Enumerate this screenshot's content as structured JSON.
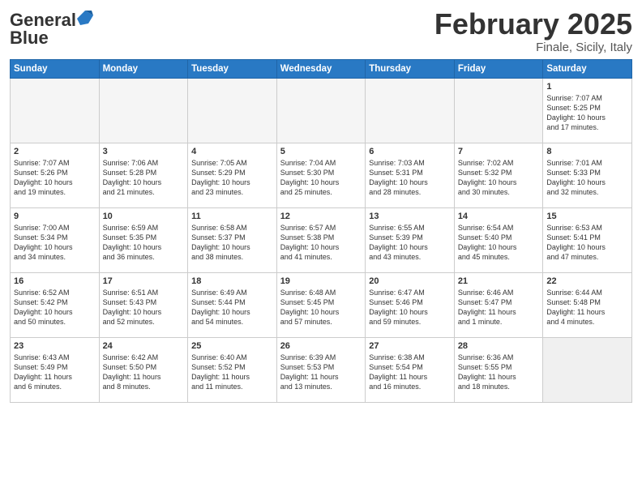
{
  "header": {
    "logo_general": "General",
    "logo_blue": "Blue",
    "month_title": "February 2025",
    "location": "Finale, Sicily, Italy"
  },
  "weekdays": [
    "Sunday",
    "Monday",
    "Tuesday",
    "Wednesday",
    "Thursday",
    "Friday",
    "Saturday"
  ],
  "weeks": [
    [
      {
        "day": "",
        "info": "",
        "empty": true
      },
      {
        "day": "",
        "info": "",
        "empty": true
      },
      {
        "day": "",
        "info": "",
        "empty": true
      },
      {
        "day": "",
        "info": "",
        "empty": true
      },
      {
        "day": "",
        "info": "",
        "empty": true
      },
      {
        "day": "",
        "info": "",
        "empty": true
      },
      {
        "day": "1",
        "info": "Sunrise: 7:07 AM\nSunset: 5:25 PM\nDaylight: 10 hours\nand 17 minutes.",
        "empty": false
      }
    ],
    [
      {
        "day": "2",
        "info": "Sunrise: 7:07 AM\nSunset: 5:26 PM\nDaylight: 10 hours\nand 19 minutes.",
        "empty": false
      },
      {
        "day": "3",
        "info": "Sunrise: 7:06 AM\nSunset: 5:28 PM\nDaylight: 10 hours\nand 21 minutes.",
        "empty": false
      },
      {
        "day": "4",
        "info": "Sunrise: 7:05 AM\nSunset: 5:29 PM\nDaylight: 10 hours\nand 23 minutes.",
        "empty": false
      },
      {
        "day": "5",
        "info": "Sunrise: 7:04 AM\nSunset: 5:30 PM\nDaylight: 10 hours\nand 25 minutes.",
        "empty": false
      },
      {
        "day": "6",
        "info": "Sunrise: 7:03 AM\nSunset: 5:31 PM\nDaylight: 10 hours\nand 28 minutes.",
        "empty": false
      },
      {
        "day": "7",
        "info": "Sunrise: 7:02 AM\nSunset: 5:32 PM\nDaylight: 10 hours\nand 30 minutes.",
        "empty": false
      },
      {
        "day": "8",
        "info": "Sunrise: 7:01 AM\nSunset: 5:33 PM\nDaylight: 10 hours\nand 32 minutes.",
        "empty": false
      }
    ],
    [
      {
        "day": "9",
        "info": "Sunrise: 7:00 AM\nSunset: 5:34 PM\nDaylight: 10 hours\nand 34 minutes.",
        "empty": false
      },
      {
        "day": "10",
        "info": "Sunrise: 6:59 AM\nSunset: 5:35 PM\nDaylight: 10 hours\nand 36 minutes.",
        "empty": false
      },
      {
        "day": "11",
        "info": "Sunrise: 6:58 AM\nSunset: 5:37 PM\nDaylight: 10 hours\nand 38 minutes.",
        "empty": false
      },
      {
        "day": "12",
        "info": "Sunrise: 6:57 AM\nSunset: 5:38 PM\nDaylight: 10 hours\nand 41 minutes.",
        "empty": false
      },
      {
        "day": "13",
        "info": "Sunrise: 6:55 AM\nSunset: 5:39 PM\nDaylight: 10 hours\nand 43 minutes.",
        "empty": false
      },
      {
        "day": "14",
        "info": "Sunrise: 6:54 AM\nSunset: 5:40 PM\nDaylight: 10 hours\nand 45 minutes.",
        "empty": false
      },
      {
        "day": "15",
        "info": "Sunrise: 6:53 AM\nSunset: 5:41 PM\nDaylight: 10 hours\nand 47 minutes.",
        "empty": false
      }
    ],
    [
      {
        "day": "16",
        "info": "Sunrise: 6:52 AM\nSunset: 5:42 PM\nDaylight: 10 hours\nand 50 minutes.",
        "empty": false
      },
      {
        "day": "17",
        "info": "Sunrise: 6:51 AM\nSunset: 5:43 PM\nDaylight: 10 hours\nand 52 minutes.",
        "empty": false
      },
      {
        "day": "18",
        "info": "Sunrise: 6:49 AM\nSunset: 5:44 PM\nDaylight: 10 hours\nand 54 minutes.",
        "empty": false
      },
      {
        "day": "19",
        "info": "Sunrise: 6:48 AM\nSunset: 5:45 PM\nDaylight: 10 hours\nand 57 minutes.",
        "empty": false
      },
      {
        "day": "20",
        "info": "Sunrise: 6:47 AM\nSunset: 5:46 PM\nDaylight: 10 hours\nand 59 minutes.",
        "empty": false
      },
      {
        "day": "21",
        "info": "Sunrise: 6:46 AM\nSunset: 5:47 PM\nDaylight: 11 hours\nand 1 minute.",
        "empty": false
      },
      {
        "day": "22",
        "info": "Sunrise: 6:44 AM\nSunset: 5:48 PM\nDaylight: 11 hours\nand 4 minutes.",
        "empty": false
      }
    ],
    [
      {
        "day": "23",
        "info": "Sunrise: 6:43 AM\nSunset: 5:49 PM\nDaylight: 11 hours\nand 6 minutes.",
        "empty": false
      },
      {
        "day": "24",
        "info": "Sunrise: 6:42 AM\nSunset: 5:50 PM\nDaylight: 11 hours\nand 8 minutes.",
        "empty": false
      },
      {
        "day": "25",
        "info": "Sunrise: 6:40 AM\nSunset: 5:52 PM\nDaylight: 11 hours\nand 11 minutes.",
        "empty": false
      },
      {
        "day": "26",
        "info": "Sunrise: 6:39 AM\nSunset: 5:53 PM\nDaylight: 11 hours\nand 13 minutes.",
        "empty": false
      },
      {
        "day": "27",
        "info": "Sunrise: 6:38 AM\nSunset: 5:54 PM\nDaylight: 11 hours\nand 16 minutes.",
        "empty": false
      },
      {
        "day": "28",
        "info": "Sunrise: 6:36 AM\nSunset: 5:55 PM\nDaylight: 11 hours\nand 18 minutes.",
        "empty": false
      },
      {
        "day": "",
        "info": "",
        "empty": true
      }
    ]
  ]
}
